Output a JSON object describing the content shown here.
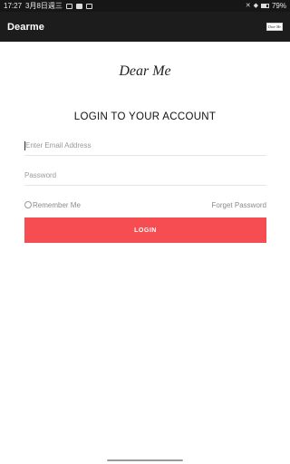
{
  "status_bar": {
    "time": "17:27",
    "date": "3月8日週三",
    "battery": "79%"
  },
  "app_bar": {
    "title": "Dearme",
    "badge": "Dear Me"
  },
  "logo": "Dear Me",
  "heading": "LOGIN TO YOUR ACCOUNT",
  "email": {
    "placeholder": "Enter Email Address",
    "value": ""
  },
  "password": {
    "placeholder": "Password",
    "value": ""
  },
  "remember_label": "Remember Me",
  "forget_label": "Forget Password",
  "login_label": "LOGIN",
  "colors": {
    "accent": "#f64d53",
    "app_bar": "#1c1c1c",
    "status_bar": "#161616"
  },
  "icons": [
    "sim-icon",
    "image-icon",
    "mail-icon",
    "mute-icon",
    "wifi-icon",
    "battery-icon"
  ]
}
